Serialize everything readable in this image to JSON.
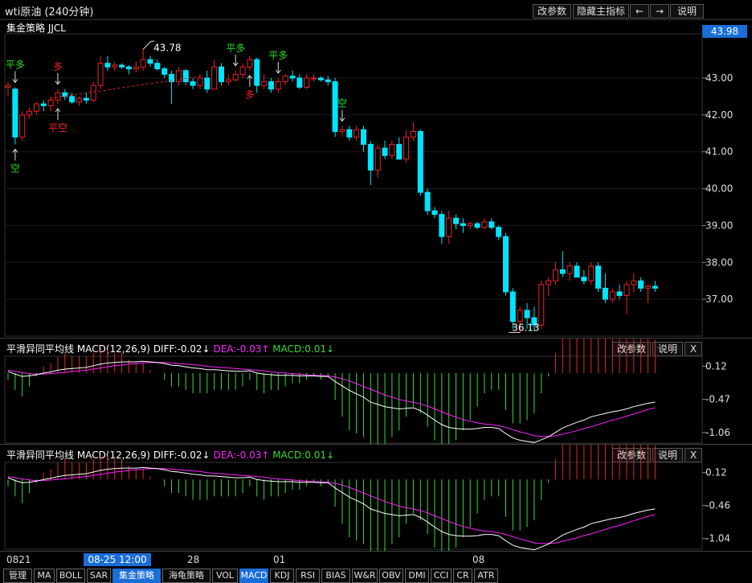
{
  "window": {
    "title": "wti原油 (240分钟)",
    "buttons": [
      "改参数",
      "隐藏主指标",
      "←",
      "→",
      "说明"
    ]
  },
  "strategy_label": "集金策略  JJCL",
  "current_price": "43.98",
  "main_chart": {
    "y_ticks": [
      "43.00",
      "42.00",
      "41.00",
      "40.00",
      "39.00",
      "38.00",
      "37.00"
    ],
    "high_label": "43.78",
    "low_label": "36.13",
    "signals": [
      {
        "text": "平多",
        "color": "#22dd22"
      },
      {
        "text": "多",
        "color": "#ee2222"
      },
      {
        "text": "平空",
        "color": "#ee2222"
      },
      {
        "text": "空",
        "color": "#22dd22"
      },
      {
        "text": "平多",
        "color": "#22dd22"
      },
      {
        "text": "多",
        "color": "#ee2222"
      },
      {
        "text": "平多",
        "color": "#22dd22"
      },
      {
        "text": "空",
        "color": "#22dd22"
      }
    ]
  },
  "macd_panels": [
    {
      "name": "平滑异同平均线",
      "params": "MACD(12,26,9)",
      "diff": "DIFF:-0.02↓",
      "dea": "DEA:-0.03↑",
      "macd": "MACD:0.01↓",
      "buttons": [
        "改参数",
        "说明",
        "X"
      ],
      "y_ticks": [
        "0.12",
        "-0.47",
        "-1.06"
      ]
    },
    {
      "name": "平滑异同平均线",
      "params": "MACD(12,26,9)",
      "diff": "DIFF:-0.02↓",
      "dea": "DEA:-0.03↑",
      "macd": "MACD:0.01↓",
      "buttons": [
        "改参数",
        "说明",
        "X"
      ],
      "y_ticks": [
        "0.12",
        "-0.46",
        "-1.04"
      ]
    }
  ],
  "time_axis": {
    "labels": [
      "0821",
      "28",
      "01",
      "08"
    ],
    "selected": "08-25 12:00"
  },
  "tabs": [
    "管理",
    "MA",
    "BOLL",
    "SAR",
    "集金策略",
    "海龟策略",
    "VOL",
    "MACD",
    "KDJ",
    "RSI",
    "BIAS",
    "W&R",
    "OBV",
    "DMI",
    "CCI",
    "CR",
    "ATR"
  ],
  "active_tabs": [
    "集金策略",
    "MACD"
  ],
  "colors": {
    "up": "#ee2222",
    "down": "#00e5ff",
    "diff": "#ffffff",
    "dea": "#ff22ff",
    "hist_pos": "#ee2222",
    "hist_neg": "#33dd33",
    "accent": "#1a6ed8"
  },
  "chart_data": {
    "type": "candlestick",
    "title": "wti原油 (240分钟)",
    "ylim": [
      36.0,
      44.2
    ],
    "candles": [
      [
        42.75,
        42.9,
        42.5,
        42.8
      ],
      [
        42.7,
        42.75,
        41.2,
        41.4
      ],
      [
        41.4,
        42.1,
        41.3,
        42.0
      ],
      [
        42.0,
        42.2,
        41.9,
        42.1
      ],
      [
        42.1,
        42.35,
        42.0,
        42.3
      ],
      [
        42.3,
        42.4,
        42.1,
        42.25
      ],
      [
        42.25,
        42.5,
        42.1,
        42.4
      ],
      [
        42.4,
        42.7,
        42.3,
        42.6
      ],
      [
        42.6,
        42.7,
        42.4,
        42.5
      ],
      [
        42.5,
        42.6,
        42.3,
        42.35
      ],
      [
        42.35,
        42.5,
        42.25,
        42.45
      ],
      [
        42.45,
        42.6,
        42.3,
        42.4
      ],
      [
        42.4,
        42.9,
        42.35,
        42.8
      ],
      [
        42.8,
        43.6,
        42.7,
        43.4
      ],
      [
        43.4,
        43.6,
        43.2,
        43.3
      ],
      [
        43.3,
        43.45,
        43.2,
        43.35
      ],
      [
        43.35,
        43.4,
        43.25,
        43.3
      ],
      [
        43.3,
        43.35,
        43.1,
        43.25
      ],
      [
        43.25,
        43.45,
        43.15,
        43.3
      ],
      [
        43.3,
        43.78,
        43.2,
        43.5
      ],
      [
        43.5,
        43.6,
        43.3,
        43.4
      ],
      [
        43.4,
        43.5,
        43.2,
        43.25
      ],
      [
        43.25,
        43.3,
        43.0,
        43.1
      ],
      [
        43.1,
        43.2,
        42.3,
        42.9
      ],
      [
        42.9,
        43.3,
        42.8,
        43.2
      ],
      [
        43.2,
        43.25,
        42.8,
        42.9
      ],
      [
        42.9,
        43.0,
        42.7,
        42.8
      ],
      [
        42.8,
        43.1,
        42.7,
        43.0
      ],
      [
        43.0,
        43.2,
        42.6,
        42.7
      ],
      [
        42.7,
        43.5,
        42.7,
        43.3
      ],
      [
        43.3,
        43.4,
        42.8,
        42.9
      ],
      [
        42.9,
        43.1,
        42.8,
        42.95
      ],
      [
        42.95,
        43.2,
        42.9,
        43.1
      ],
      [
        43.1,
        43.4,
        43.0,
        43.3
      ],
      [
        43.3,
        43.6,
        43.2,
        43.5
      ],
      [
        43.5,
        43.55,
        42.6,
        42.8
      ],
      [
        42.8,
        43.1,
        42.7,
        42.9
      ],
      [
        42.9,
        43.0,
        42.6,
        42.7
      ],
      [
        42.7,
        43.0,
        42.6,
        42.9
      ],
      [
        42.9,
        43.1,
        42.8,
        43.05
      ],
      [
        43.05,
        43.2,
        42.9,
        43.0
      ],
      [
        43.0,
        43.1,
        42.7,
        42.75
      ],
      [
        42.75,
        43.1,
        42.7,
        43.0
      ],
      [
        43.0,
        43.1,
        42.9,
        43.0
      ],
      [
        43.0,
        43.05,
        42.9,
        42.95
      ],
      [
        42.95,
        43.05,
        42.8,
        42.9
      ],
      [
        42.9,
        43.0,
        41.4,
        41.55
      ],
      [
        41.55,
        41.7,
        41.4,
        41.6
      ],
      [
        41.6,
        41.7,
        41.3,
        41.4
      ],
      [
        41.4,
        41.7,
        41.3,
        41.6
      ],
      [
        41.6,
        41.7,
        41.0,
        41.2
      ],
      [
        41.2,
        41.3,
        40.1,
        40.5
      ],
      [
        40.5,
        41.2,
        40.3,
        41.1
      ],
      [
        41.1,
        41.3,
        40.8,
        40.9
      ],
      [
        40.9,
        41.3,
        40.8,
        41.2
      ],
      [
        41.2,
        41.4,
        40.8,
        40.8
      ],
      [
        40.8,
        41.6,
        40.7,
        41.4
      ],
      [
        41.4,
        41.8,
        41.3,
        41.55
      ],
      [
        41.55,
        41.6,
        39.8,
        39.9
      ],
      [
        39.9,
        40.0,
        39.3,
        39.4
      ],
      [
        39.4,
        39.5,
        39.2,
        39.3
      ],
      [
        39.3,
        39.4,
        38.5,
        38.7
      ],
      [
        38.7,
        39.4,
        38.5,
        39.2
      ],
      [
        39.2,
        39.3,
        38.9,
        39.05
      ],
      [
        39.05,
        39.2,
        38.8,
        39.0
      ],
      [
        39.0,
        39.1,
        38.9,
        39.05
      ],
      [
        39.05,
        39.1,
        38.9,
        38.95
      ],
      [
        38.95,
        39.2,
        38.9,
        39.1
      ],
      [
        39.1,
        39.2,
        38.9,
        38.95
      ],
      [
        38.95,
        39.0,
        38.6,
        38.7
      ],
      [
        38.7,
        38.8,
        37.1,
        37.2
      ],
      [
        37.2,
        37.3,
        36.2,
        36.4
      ],
      [
        36.4,
        36.8,
        36.1,
        36.7
      ],
      [
        36.7,
        36.9,
        36.2,
        36.5
      ],
      [
        36.5,
        36.8,
        36.13,
        36.3
      ],
      [
        36.3,
        37.5,
        36.2,
        37.4
      ],
      [
        37.4,
        37.6,
        37.1,
        37.5
      ],
      [
        37.5,
        38.0,
        37.4,
        37.8
      ],
      [
        37.8,
        38.3,
        37.6,
        37.7
      ],
      [
        37.7,
        38.0,
        37.5,
        37.9
      ],
      [
        37.9,
        38.0,
        37.6,
        37.6
      ],
      [
        37.6,
        37.8,
        37.4,
        37.5
      ],
      [
        37.5,
        38.0,
        37.4,
        37.9
      ],
      [
        37.9,
        38.0,
        37.2,
        37.3
      ],
      [
        37.3,
        37.7,
        36.9,
        37.0
      ],
      [
        37.0,
        37.3,
        36.9,
        37.2
      ],
      [
        37.2,
        37.4,
        37.0,
        37.1
      ],
      [
        37.1,
        37.5,
        36.6,
        37.4
      ],
      [
        37.4,
        37.7,
        37.2,
        37.5
      ],
      [
        37.5,
        37.6,
        37.2,
        37.3
      ],
      [
        37.3,
        37.4,
        36.9,
        37.35
      ],
      [
        37.35,
        37.5,
        37.2,
        37.3
      ]
    ],
    "macd1": {
      "ylim": [
        -1.25,
        0.3
      ],
      "diff": [
        0.03,
        -0.02,
        -0.06,
        -0.05,
        -0.03,
        0.0,
        0.02,
        0.05,
        0.07,
        0.08,
        0.09,
        0.1,
        0.13,
        0.16,
        0.18,
        0.19,
        0.2,
        0.2,
        0.2,
        0.21,
        0.2,
        0.19,
        0.17,
        0.14,
        0.13,
        0.11,
        0.09,
        0.08,
        0.06,
        0.06,
        0.05,
        0.04,
        0.03,
        0.03,
        0.04,
        0.0,
        -0.02,
        -0.03,
        -0.04,
        -0.04,
        -0.04,
        -0.05,
        -0.05,
        -0.05,
        -0.06,
        -0.06,
        -0.15,
        -0.23,
        -0.31,
        -0.37,
        -0.43,
        -0.52,
        -0.56,
        -0.6,
        -0.62,
        -0.64,
        -0.63,
        -0.62,
        -0.67,
        -0.75,
        -0.84,
        -0.92,
        -0.97,
        -0.99,
        -1.0,
        -1.0,
        -0.99,
        -0.97,
        -0.97,
        -0.99,
        -1.08,
        -1.16,
        -1.2,
        -1.22,
        -1.24,
        -1.19,
        -1.14,
        -1.06,
        -0.98,
        -0.93,
        -0.88,
        -0.84,
        -0.78,
        -0.75,
        -0.72,
        -0.69,
        -0.67,
        -0.64,
        -0.6,
        -0.57,
        -0.54,
        -0.52
      ],
      "dea": [
        0.05,
        0.03,
        0.01,
        -0.01,
        -0.02,
        -0.02,
        -0.01,
        0.0,
        0.01,
        0.03,
        0.04,
        0.05,
        0.07,
        0.09,
        0.11,
        0.13,
        0.14,
        0.16,
        0.17,
        0.18,
        0.19,
        0.19,
        0.19,
        0.18,
        0.17,
        0.16,
        0.15,
        0.14,
        0.12,
        0.11,
        0.1,
        0.09,
        0.08,
        0.07,
        0.06,
        0.05,
        0.04,
        0.02,
        0.01,
        0.0,
        -0.01,
        -0.02,
        -0.03,
        -0.04,
        -0.04,
        -0.05,
        -0.07,
        -0.1,
        -0.14,
        -0.19,
        -0.24,
        -0.29,
        -0.34,
        -0.39,
        -0.43,
        -0.47,
        -0.5,
        -0.52,
        -0.55,
        -0.59,
        -0.64,
        -0.69,
        -0.74,
        -0.79,
        -0.83,
        -0.86,
        -0.89,
        -0.91,
        -0.92,
        -0.94,
        -0.97,
        -1.01,
        -1.05,
        -1.08,
        -1.12,
        -1.13,
        -1.13,
        -1.12,
        -1.09,
        -1.06,
        -1.03,
        -0.99,
        -0.96,
        -0.92,
        -0.88,
        -0.84,
        -0.81,
        -0.77,
        -0.73,
        -0.69,
        -0.65,
        -0.62
      ]
    },
    "macd2": {
      "ylim": [
        -1.23,
        0.3
      ]
    }
  }
}
